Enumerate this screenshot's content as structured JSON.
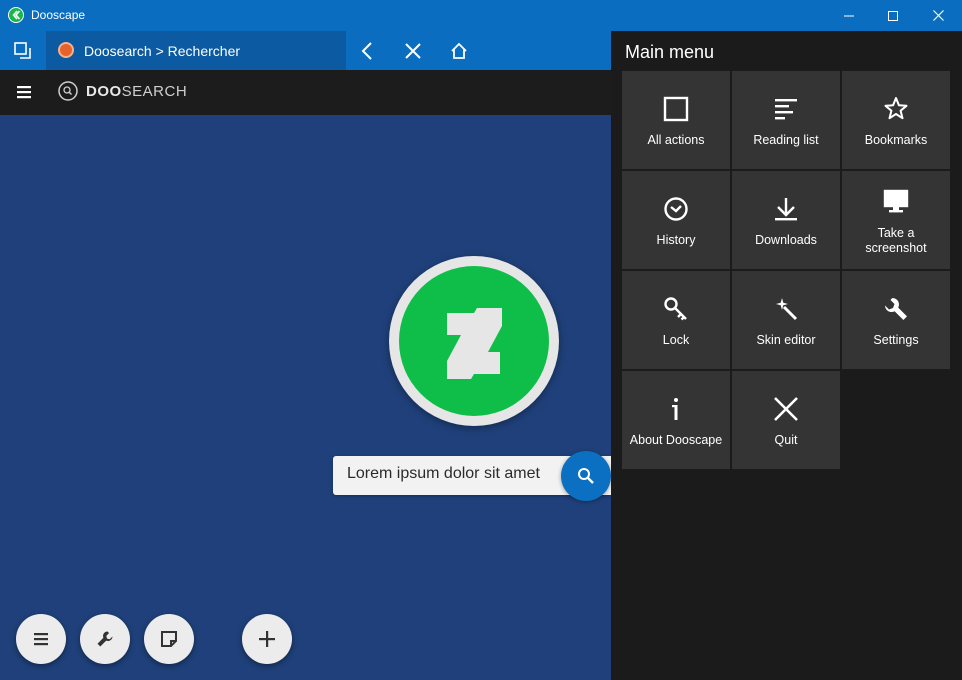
{
  "window": {
    "title": "Dooscape"
  },
  "tab": {
    "label": "Doosearch > Rechercher"
  },
  "header": {
    "logo_bold": "DOO",
    "logo_light": "SEARCH"
  },
  "search": {
    "value": "Lorem ipsum dolor sit amet"
  },
  "menu": {
    "title": "Main menu",
    "items": [
      {
        "label": "All actions",
        "icon": "square-icon"
      },
      {
        "label": "Reading list",
        "icon": "reading-list-icon"
      },
      {
        "label": "Bookmarks",
        "icon": "star-icon"
      },
      {
        "label": "History",
        "icon": "clock-icon"
      },
      {
        "label": "Downloads",
        "icon": "download-icon"
      },
      {
        "label": "Take a screenshot",
        "icon": "monitor-icon"
      },
      {
        "label": "Lock",
        "icon": "key-icon"
      },
      {
        "label": "Skin editor",
        "icon": "magic-wand-icon"
      },
      {
        "label": "Settings",
        "icon": "wrench-icon"
      },
      {
        "label": "About Dooscape",
        "icon": "info-icon"
      },
      {
        "label": "Quit",
        "icon": "close-icon"
      }
    ]
  },
  "colors": {
    "titlebar": "#0a6dc0",
    "page_background": "#1f407a",
    "menu_background": "#1b1b1b",
    "tile_background": "#343434",
    "brand_green": "#0fbd49",
    "search_button": "#0b6fc2"
  }
}
